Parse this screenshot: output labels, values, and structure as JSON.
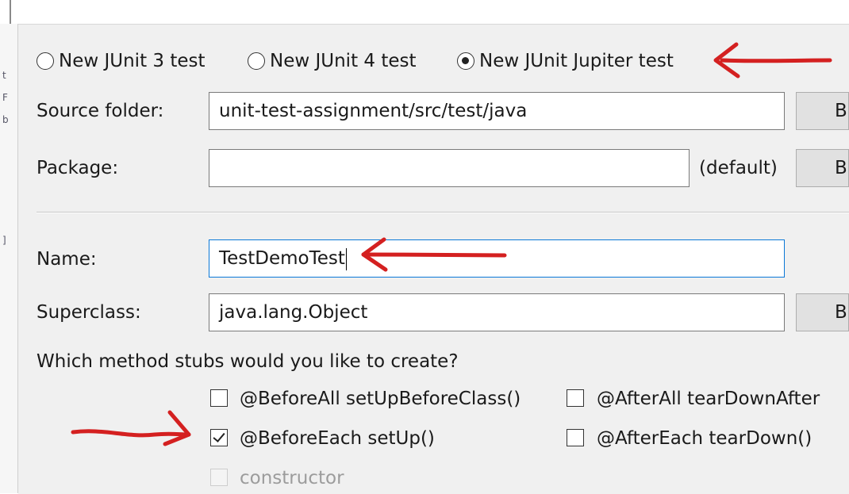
{
  "test_type": {
    "options": [
      {
        "label": "New JUnit 3 test",
        "selected": false
      },
      {
        "label": "New JUnit 4 test",
        "selected": false
      },
      {
        "label": "New JUnit Jupiter test",
        "selected": true
      }
    ]
  },
  "source_folder": {
    "label": "Source folder:",
    "value": "unit-test-assignment/src/test/java",
    "browse_label": "B"
  },
  "package": {
    "label": "Package:",
    "value": "",
    "default_label": "(default)",
    "browse_label": "B"
  },
  "name": {
    "label": "Name:",
    "value": "TestDemoTest"
  },
  "superclass": {
    "label": "Superclass:",
    "value": "java.lang.Object",
    "browse_label": "B"
  },
  "method_stubs": {
    "question": "Which method stubs would you like to create?",
    "options": [
      {
        "label": "@BeforeAll setUpBeforeClass()",
        "checked": false,
        "enabled": true
      },
      {
        "label": "@AfterAll tearDownAfter",
        "checked": false,
        "enabled": true
      },
      {
        "label": "@BeforeEach setUp()",
        "checked": true,
        "enabled": true
      },
      {
        "label": "@AfterEach tearDown()",
        "checked": false,
        "enabled": true
      },
      {
        "label": "constructor",
        "checked": false,
        "enabled": false
      }
    ]
  },
  "annotations": {
    "arrow_color": "#d42020"
  },
  "colors": {
    "focus_border": "#0a78d7",
    "panel_bg": "#f0f0f0"
  }
}
